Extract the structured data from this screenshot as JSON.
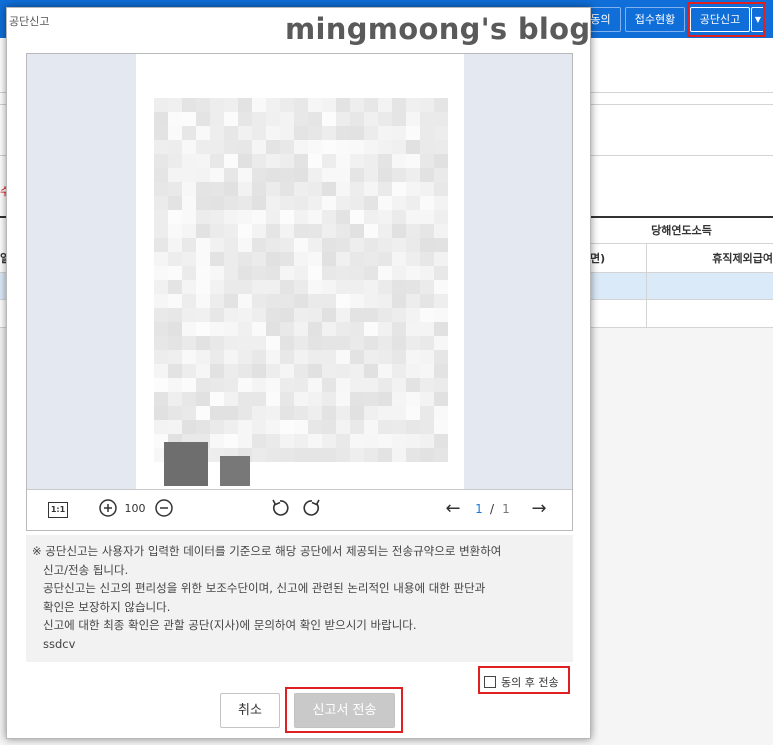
{
  "app": {
    "toolbar": {
      "agree_label": "동의",
      "status_label": "접수현황",
      "report_label": "공단신고",
      "dropdown_icon": "caret-down-icon"
    },
    "table": {
      "group_header": "당해연도소득",
      "col_header_a": "면)",
      "col_header_b": "휴직제외급여",
      "col_header_left": "일",
      "red_mark": "수"
    }
  },
  "modal": {
    "title": "공단신고",
    "watermark": "mingmoong's blog",
    "viewer": {
      "fit_label": "1:1",
      "zoom_in_icon": "zoom-in-icon",
      "zoom_value": "100",
      "zoom_out_icon": "zoom-out-icon",
      "rotate_left_icon": "rotate-left-icon",
      "rotate_right_icon": "rotate-right-icon",
      "prev_icon": "arrow-left-icon",
      "next_icon": "arrow-right-icon",
      "page_current": "1",
      "page_separator": "/",
      "page_total": "1"
    },
    "notice": [
      "※ 공단신고는 사용자가 입력한 데이터를 기준으로 해당 공단에서 제공되는 전송규약으로 변환하여",
      "신고/전송 됩니다.",
      "공단신고는 신고의 편리성을 위한 보조수단이며, 신고에 관련된 논리적인 내용에 대한 판단과",
      "확인은 보장하지 않습니다.",
      "신고에 대한 최종 확인은 관할 공단(지사)에 문의하여 확인 받으시기 바랍니다.",
      "ssdcv"
    ],
    "agree_checkbox_label": "동의 후 전송",
    "cancel_label": "취소",
    "send_label": "신고서 전송"
  },
  "colors": {
    "topbar": "#0f6ed8",
    "highlight_box": "#e02020",
    "selected_row": "#dbeaf8",
    "disabled_button": "#c9c9c9",
    "page_link": "#1f7ad9"
  }
}
